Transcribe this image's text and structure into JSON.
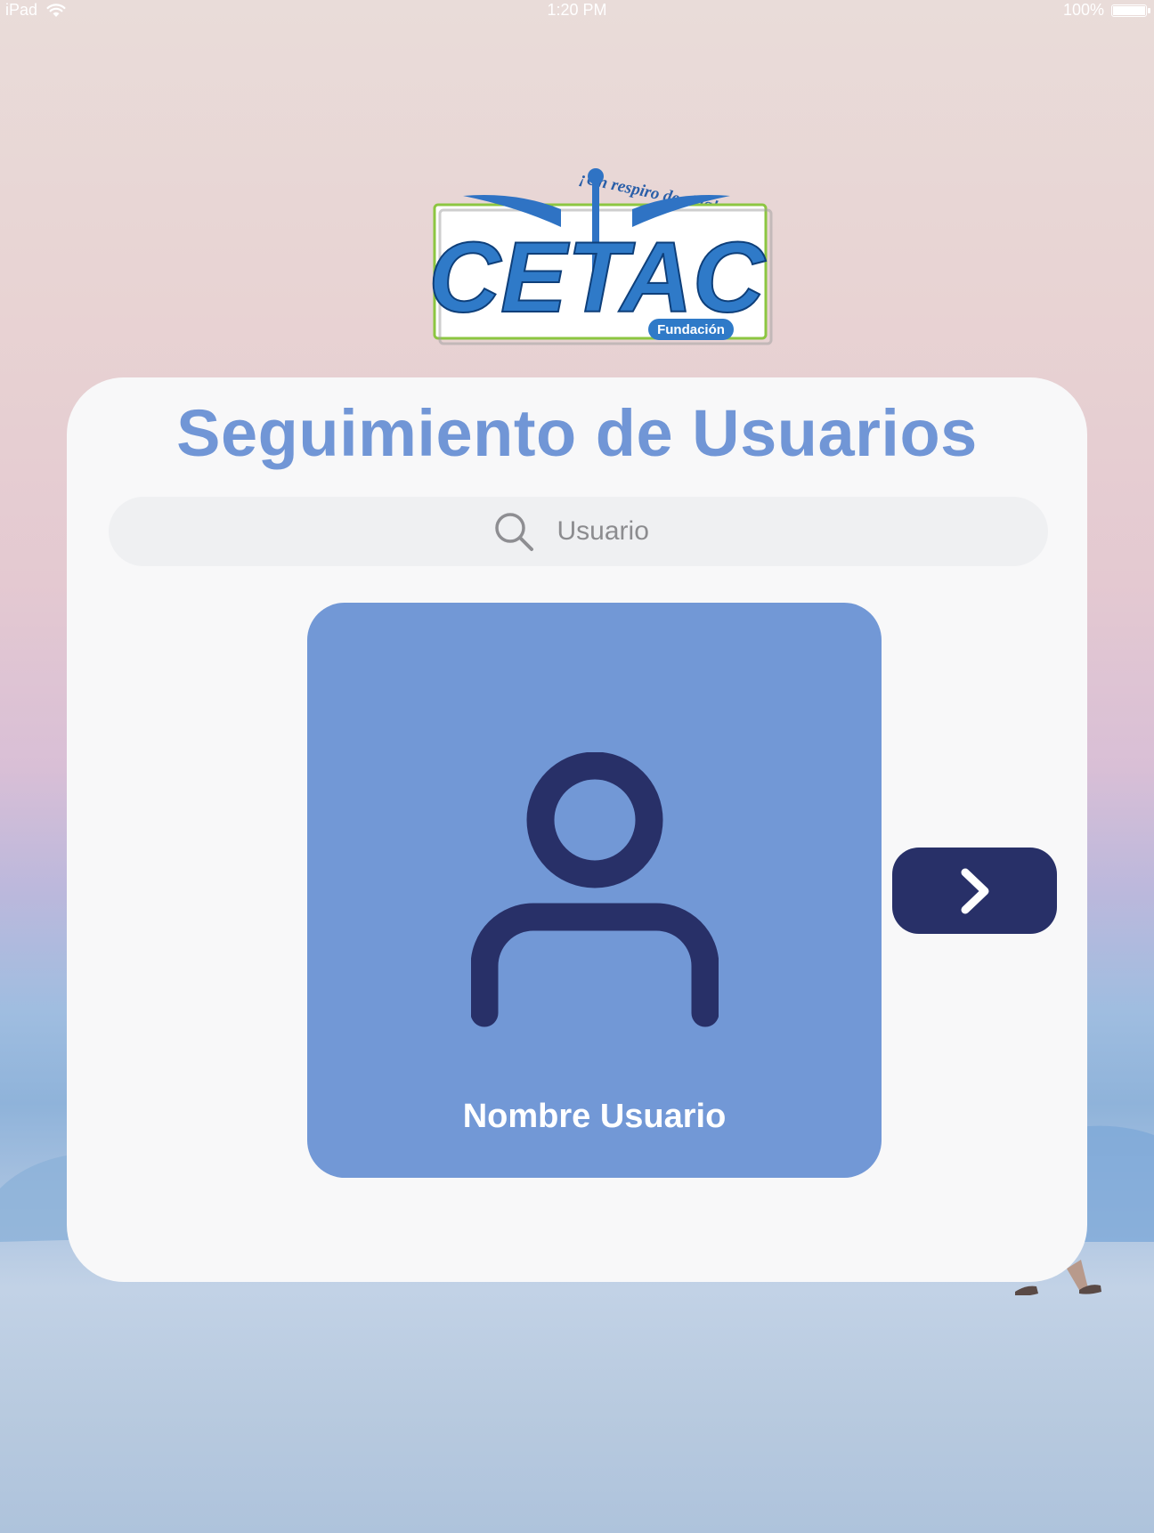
{
  "status_bar": {
    "device": "iPad",
    "time": "1:20 PM",
    "battery": "100%",
    "battery_level": 1.0
  },
  "logo": {
    "tagline": "¡Un respiro de vida!",
    "name": "CETAC",
    "subtitle": "Fundación"
  },
  "page": {
    "title": "Seguimiento de Usuarios"
  },
  "search": {
    "placeholder": "Usuario",
    "value": ""
  },
  "user_card": {
    "name": "Nombre Usuario"
  },
  "icons": {
    "search": "search-icon",
    "user": "user-icon",
    "next": "chevron-right-icon",
    "wifi": "wifi-icon",
    "battery": "battery-icon"
  },
  "colors": {
    "title": "#7196d6",
    "tile": "#7298d6",
    "icon_dark": "#283068",
    "card": "#f8f8f9",
    "search_bg": "#eff0f2"
  }
}
